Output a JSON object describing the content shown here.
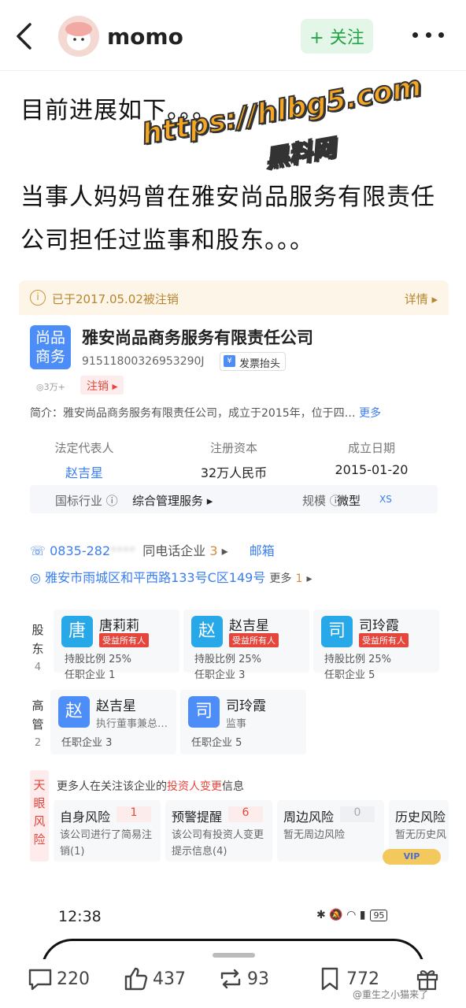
{
  "header": {
    "username": "momo",
    "follow_label": "+ 关注"
  },
  "post": {
    "line1": "目前进展如下。。。",
    "line2": "当事人妈妈曾在雅安尚品服务有限责任",
    "line3": "公司担任过监事和股东。。。"
  },
  "watermark": {
    "url": "https://hlbg5.com",
    "name": "黑料网"
  },
  "card": {
    "notice": "已于2017.05.02被注销",
    "notice_icon": "i",
    "detail": "详情 ▸",
    "logo_line1": "尚品",
    "logo_line2": "商务",
    "company_name": "雅安尚品商务服务有限责任公司",
    "credit_code": "91511800326953290J",
    "invoice_label": "发票抬头",
    "invoice_icon": "¥",
    "views": "◎3万+",
    "status": "注销 ▸",
    "intro_prefix": "简介：",
    "intro": "雅安尚品商务服务有限责任公司，成立于2015年，位于四…",
    "intro_more": "更多",
    "legal_rep_label": "法定代表人",
    "legal_rep": "赵吉星",
    "capital_label": "注册资本",
    "capital": "32万人民币",
    "founded_label": "成立日期",
    "founded": "2015-01-20",
    "industry_label": "国标行业 ⓘ",
    "industry": "综合管理服务 ▸",
    "scale_label": "规模 ⓘ",
    "scale": "微型",
    "scale_code": "XS",
    "phone_icon": "☏",
    "phone": "0835-282",
    "phone_mask": "****",
    "same_phone_label": "同电话企业",
    "same_phone_count": "3",
    "same_phone_arrow": "▸",
    "email_label": "邮箱",
    "address_icon": "◎",
    "address": "雅安市雨城区和平西路133号C区149号",
    "address_more": "更多",
    "address_more_count": "1",
    "address_more_arrow": "▸",
    "shareholder_label_chars": [
      "股",
      "东"
    ],
    "shareholder_count": "4",
    "exec_label_chars": [
      "高",
      "管"
    ],
    "exec_count": "2",
    "shareholders": [
      {
        "avatar": "唐",
        "name": "唐莉莉",
        "tag": "受益所有人",
        "ratio": "持股比例 25%",
        "jobs": "任职企业 1",
        "color": "#27a8e8"
      },
      {
        "avatar": "赵",
        "name": "赵吉星",
        "tag": "受益所有人",
        "ratio": "持股比例 25%",
        "jobs": "任职企业 3",
        "color": "#27a8e8"
      },
      {
        "avatar": "司",
        "name": "司玲霞",
        "tag": "受益所有人",
        "ratio": "持股比例 25%",
        "jobs": "任职企业 5",
        "color": "#27a8e8"
      }
    ],
    "executives": [
      {
        "avatar": "赵",
        "name": "赵吉星",
        "role": "执行董事兼总…",
        "jobs": "任职企业 3",
        "color": "#4d8df7"
      },
      {
        "avatar": "司",
        "name": "司玲霞",
        "role": "监事",
        "jobs": "任职企业 5",
        "color": "#4d8df7"
      }
    ],
    "risk_side": [
      "天",
      "眼",
      "风",
      "险"
    ],
    "risk_head_prefix": "更多人在关注该企业的",
    "risk_head_highlight": "投资人变更",
    "risk_head_suffix": "信息",
    "risks": [
      {
        "title": "自身风险",
        "count": "1",
        "desc": "该公司进行了简易注销(1)"
      },
      {
        "title": "预警提醒",
        "count": "6",
        "desc": "该公司有投资人变更提示信息(4)"
      },
      {
        "title": "周边风险",
        "count": "0",
        "desc": "暂无周边风险"
      },
      {
        "title": "历史风险",
        "count": "",
        "desc": "暂无历史风"
      }
    ],
    "vip_label": "VIP"
  },
  "status_bar": {
    "time": "12:38",
    "icons": "✱ 🔕 ◠ ▮",
    "battery": "95"
  },
  "actions": {
    "comments": "220",
    "likes": "437",
    "reposts": "93",
    "favorites": "772"
  },
  "source": "@重生之小猫来了"
}
